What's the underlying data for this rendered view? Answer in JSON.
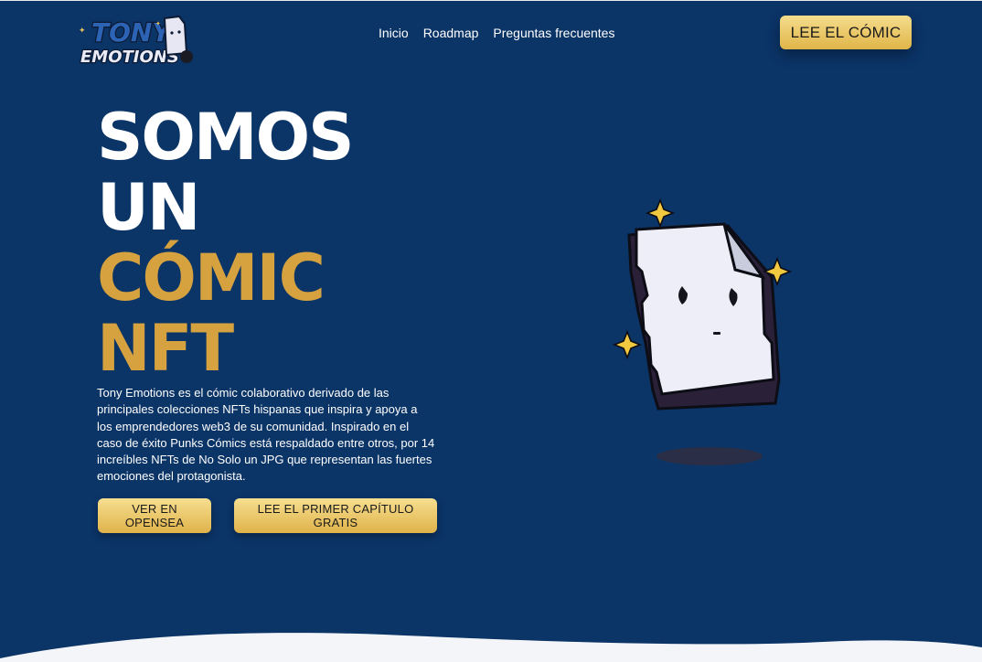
{
  "logo": {
    "line1": "TONY",
    "line2": "EMOTIONS"
  },
  "nav": {
    "items": [
      "Inicio",
      "Roadmap",
      "Preguntas frecuentes"
    ]
  },
  "header": {
    "cta_label": "LEE EL CÓMIC"
  },
  "hero": {
    "title_lines": [
      "SOMOS",
      "UN",
      "CÓMIC",
      "NFT"
    ],
    "description": "Tony Emotions es el cómic colaborativo derivado de las principales colecciones NFTs hispanas que inspira y apoya a los emprendedores web3 de su comunidad. Inspirado en el caso de éxito Punks Cómics está respaldado entre otros, por 14 increíbles NFTs de No Solo un JPG que representan las fuertes emociones del protagonista.",
    "buttons": {
      "opensea": "VER EN OPENSEA",
      "first_chapter": "LEE EL PRIMER CAPÍTULO GRATIS"
    }
  },
  "colors": {
    "background": "#0b3467",
    "accent_gold": "#d5a23f",
    "button_gold_light": "#f7df90",
    "button_gold_dark": "#dfb24a",
    "text": "#ffffff"
  },
  "illustration": {
    "name": "paper-character-mascot"
  }
}
